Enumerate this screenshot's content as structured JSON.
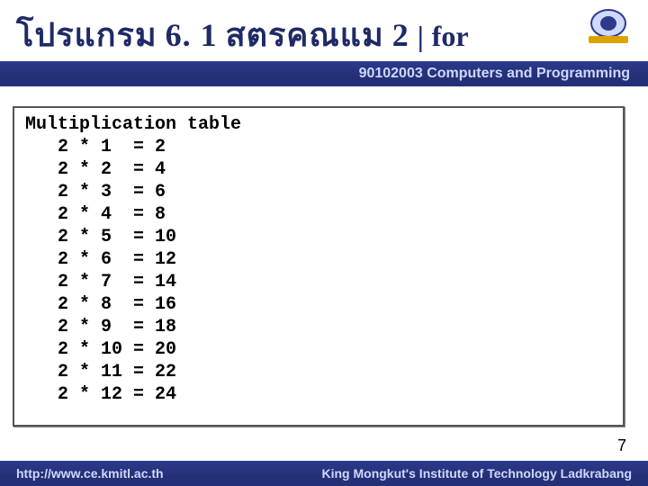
{
  "header": {
    "title_th_1": "โปรแกรม",
    "title_num": "6. 1",
    "title_th_2": "สตรคณแม",
    "title_tail_num": "2",
    "title_pipe": "|",
    "title_for": "for"
  },
  "course_bar": "90102003 Computers and Programming",
  "code": {
    "heading": "Multiplication table",
    "rows": [
      {
        "a": 2,
        "b": 1,
        "r": 2
      },
      {
        "a": 2,
        "b": 2,
        "r": 4
      },
      {
        "a": 2,
        "b": 3,
        "r": 6
      },
      {
        "a": 2,
        "b": 4,
        "r": 8
      },
      {
        "a": 2,
        "b": 5,
        "r": 10
      },
      {
        "a": 2,
        "b": 6,
        "r": 12
      },
      {
        "a": 2,
        "b": 7,
        "r": 14
      },
      {
        "a": 2,
        "b": 8,
        "r": 16
      },
      {
        "a": 2,
        "b": 9,
        "r": 18
      },
      {
        "a": 2,
        "b": 10,
        "r": 20
      },
      {
        "a": 2,
        "b": 11,
        "r": 22
      },
      {
        "a": 2,
        "b": 12,
        "r": 24
      }
    ]
  },
  "page_number": "7",
  "footer": {
    "left": "http://www.ce.kmitl.ac.th",
    "right": "King Mongkut's Institute of Technology Ladkrabang"
  }
}
